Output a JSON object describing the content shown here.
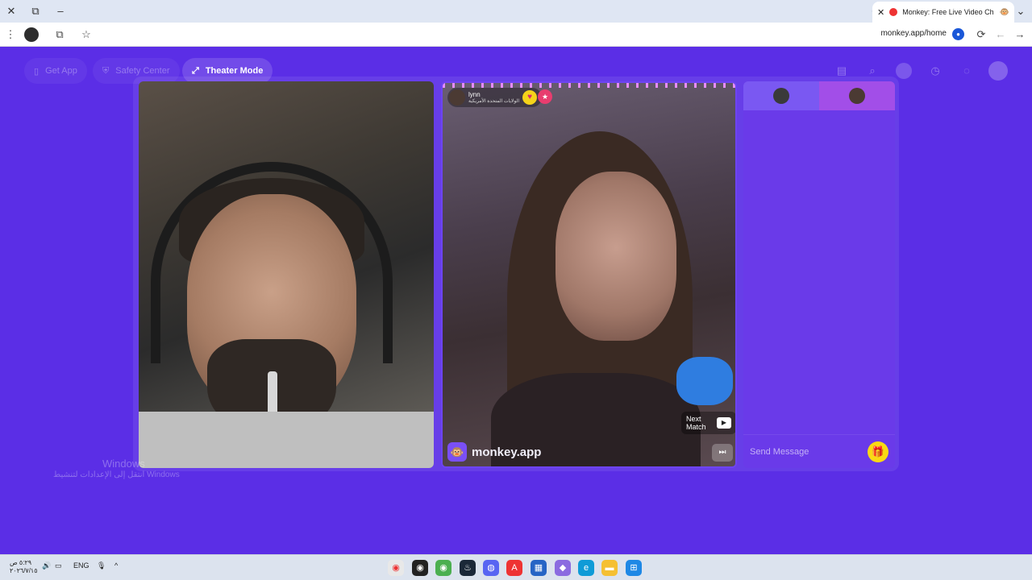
{
  "browser": {
    "tab_title": "Monkey: Free Live Video Ch",
    "url": "monkey.app/home",
    "close_glyph": "✕",
    "new_tab_glyph": "+",
    "restore_glyph": "⧉",
    "minimize_glyph": "–",
    "chevron_glyph": "⌄",
    "menu_glyph": "⋮",
    "star_glyph": "☆",
    "reload_glyph": "⟳",
    "back_glyph": "←",
    "forward_glyph": "→"
  },
  "topbar": {
    "get_app": "Get App",
    "safety_center": "Safety Center",
    "theater_mode": "Theater Mode"
  },
  "partner": {
    "name": "lynn",
    "location": "الولايات المتحدة الأمريكية"
  },
  "controls": {
    "next_match": "Next Match",
    "brand": "monkey.app"
  },
  "chat": {
    "placeholder": "Send Message"
  },
  "watermark": {
    "line1": "Windows",
    "line2": "انتقل إلى الإعدادات لتنشيط Windows"
  },
  "taskbar": {
    "clock_time": "٥:٢٩ ص",
    "clock_date": "٢٠٢٦/٧/١٥",
    "lang": "ENG",
    "tray_chevron": "^"
  },
  "colors": {
    "app_bg": "#5b2ee6",
    "chat_tab_partner": "#a24ee8",
    "gift": "#f9d914"
  }
}
